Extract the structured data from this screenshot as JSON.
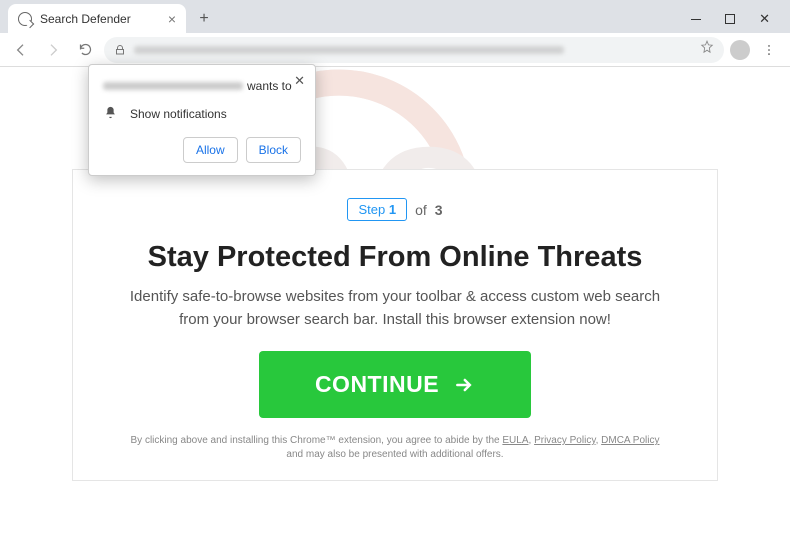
{
  "browser": {
    "tab_title": "Search Defender",
    "window_controls": {
      "min": "−",
      "max": "□",
      "close": "✕"
    }
  },
  "notification": {
    "wants_to": "wants to",
    "show_notifications": "Show notifications",
    "allow": "Allow",
    "block": "Block",
    "close": "✕"
  },
  "panel": {
    "step_label": "Step",
    "step_num": "1",
    "step_of": "of",
    "step_total": "3",
    "headline": "Stay Protected From Online Threats",
    "subtext": "Identify safe-to-browse websites from your toolbar & access custom web search from your browser search bar. Install this browser extension now!",
    "cta": "CONTINUE",
    "disclaimer_pre": "By clicking above and installing this Chrome™ extension, you agree to abide by the ",
    "eula": "EULA",
    "privacy": "Privacy Policy",
    "dmca": "DMCA Policy",
    "disclaimer_mid": " and may also be presented with additional offers."
  }
}
